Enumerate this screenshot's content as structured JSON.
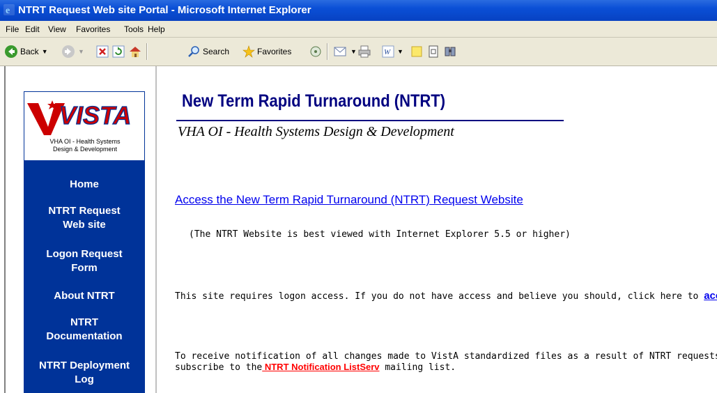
{
  "window": {
    "title": "NTRT Request Web site Portal - Microsoft Internet Explorer"
  },
  "menu": [
    "File",
    "Edit",
    "View",
    "Favorites",
    "Tools",
    "Help"
  ],
  "toolbar": {
    "back_label": "Back",
    "search_label": "Search",
    "favorites_label": "Favorites"
  },
  "sidebar": {
    "logo_text": "VISTA",
    "logo_line1": "VHA OI - Health Systems",
    "logo_line2": "Design & Development",
    "nav": [
      {
        "line1": "Home",
        "line2": ""
      },
      {
        "line1": "NTRT Request",
        "line2": "Web site"
      },
      {
        "line1": "Logon Request",
        "line2": "Form"
      },
      {
        "line1": "About NTRT",
        "line2": ""
      },
      {
        "line1": "NTRT",
        "line2": "Documentation"
      },
      {
        "line1": "NTRT Deployment",
        "line2": "Log"
      }
    ]
  },
  "main": {
    "heading": "New Term Rapid Turnaround (NTRT)",
    "subtitle": "VHA OI - Health Systems Design & Development",
    "access_link": "Access the New Term Rapid Turnaround (NTRT) Request Website",
    "browser_note": "(The NTRT Website is best viewed with Internet Explorer 5.5 or higher)",
    "logon_text": "This site requires logon access.  If you do not have access and believe you should, click here to ",
    "logon_link": "acce",
    "notify_line1": "To receive notification of all changes made to VistA standardized files as a result of NTRT requests yo",
    "notify_line2_pre": "subscribe to the",
    "notify_link": " NTRT Notification ListServ",
    "notify_line2_post": " mailing list."
  }
}
